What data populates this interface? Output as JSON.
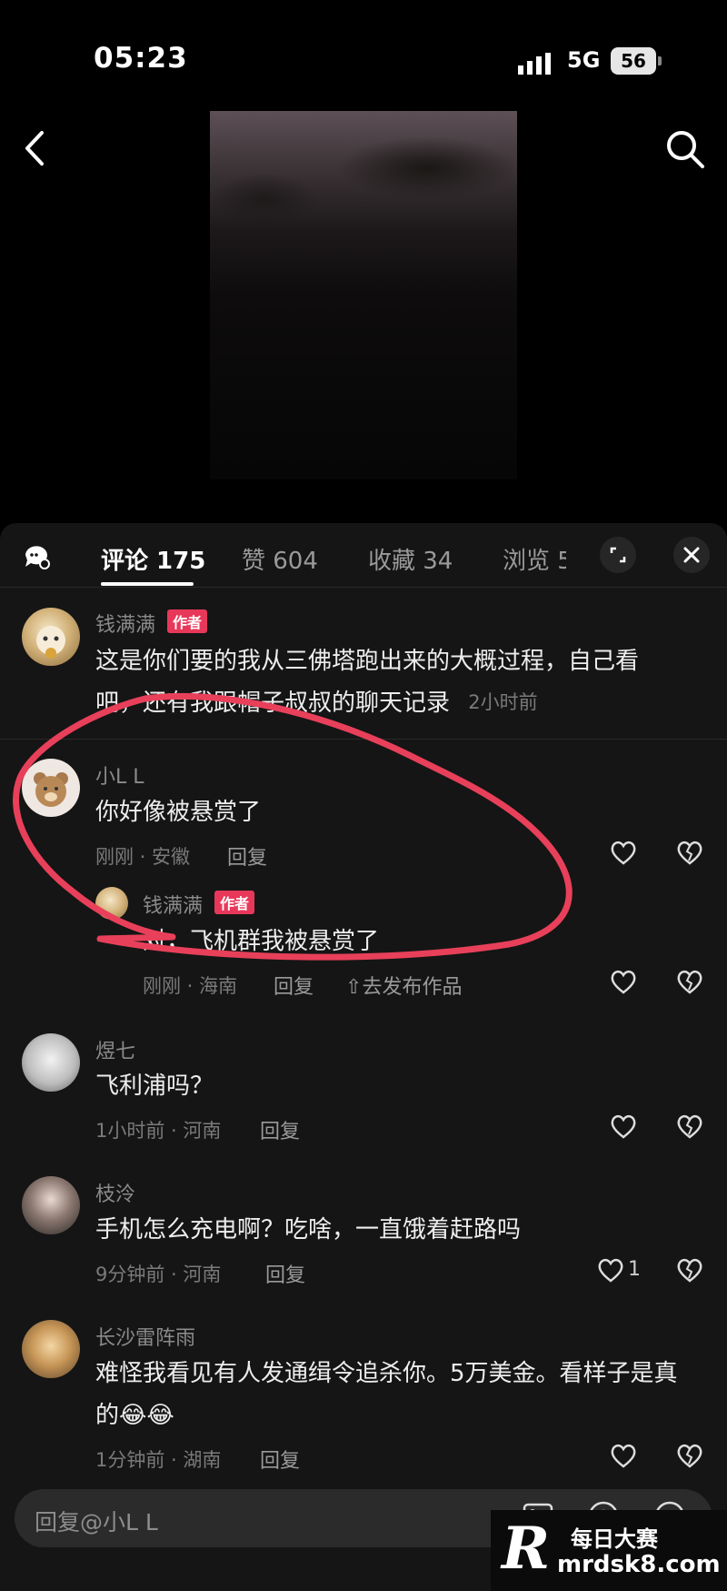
{
  "status_bar": {
    "time": "05:23",
    "network": "5G",
    "battery": "56"
  },
  "tabs": {
    "comments": "评论 175",
    "likes": "赞 604",
    "saves": "收藏 34",
    "views": "浏览 5"
  },
  "comments": [
    {
      "user": "钱满满",
      "badge": "作者",
      "text_lines": [
        "这是你们要的我从三佛塔跑出来的大概过程，自己看",
        "吧，还有我跟帽子叔叔的聊天记录"
      ],
      "time": "2小时前"
    },
    {
      "user": "小L L",
      "text": "你好像被悬赏了",
      "meta": "刚刚 · 安徽",
      "reply_label": "回复",
      "reply": {
        "user": "钱满满",
        "badge": "作者",
        "text": "对，飞机群我被悬赏了",
        "meta": "刚刚 · 海南",
        "reply_label": "回复",
        "publish": "去发布作品"
      }
    },
    {
      "user": "煜七",
      "text": "飞利浦吗？",
      "meta": "1小时前 · 河南",
      "reply_label": "回复"
    },
    {
      "user": "枝泠",
      "text": "手机怎么充电啊？吃啥，一直饿着赶路吗",
      "meta": "9分钟前 · 河南",
      "reply_label": "回复",
      "likes": "1"
    },
    {
      "user": "长沙雷阵雨",
      "text_lines": [
        "难怪我看见有人发通缉令追杀你。5万美金。看样子是真",
        "的😂😂"
      ],
      "meta": "1分钟前 · 湖南",
      "reply_label": "回复"
    }
  ],
  "input": {
    "placeholder": "回复@小L L"
  },
  "watermark": {
    "letter": "R",
    "title": "每日大赛",
    "url": "mrdsk8.com"
  },
  "colors": {
    "author_badge": "#e8385a",
    "annotation": "#e8405a",
    "sheet_bg": "#151515"
  }
}
